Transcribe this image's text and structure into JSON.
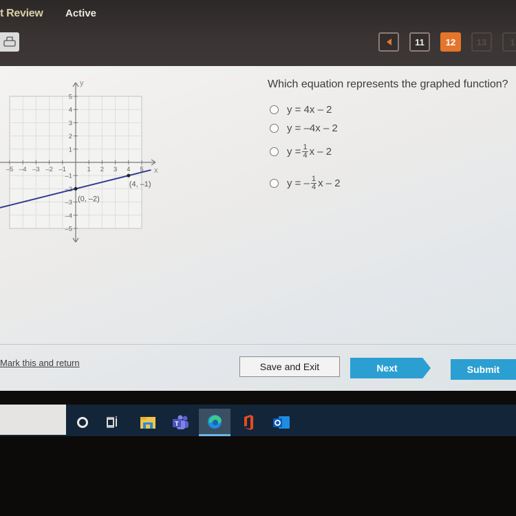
{
  "header": {
    "title": "t Review",
    "status": "Active",
    "print_icon": "printer-icon"
  },
  "question_nav": {
    "prev_icon": "triangle-left-icon",
    "items": [
      {
        "label": "11",
        "state": "visited"
      },
      {
        "label": "12",
        "state": "current"
      },
      {
        "label": "13",
        "state": "unvisited"
      },
      {
        "label": "1",
        "state": "unvisited"
      }
    ],
    "accent": "#e4752b"
  },
  "graph": {
    "axis_x_label": "x",
    "axis_y_label": "y",
    "x_range": [
      -5,
      5
    ],
    "y_range": [
      -5,
      5
    ],
    "x_ticks": [
      "-5",
      "-4",
      "-3",
      "-2",
      "-1",
      "1",
      "2",
      "3",
      "4",
      "5"
    ],
    "y_ticks": [
      "5",
      "4",
      "3",
      "2",
      "1",
      "-1",
      "-2",
      "-3",
      "-4",
      "-5"
    ],
    "line_color": "#2f3a8f",
    "points": [
      {
        "x": 0,
        "y": -2,
        "label": "(0, -2)"
      },
      {
        "x": 4,
        "y": -1,
        "label": "(4, -1)"
      }
    ],
    "line": {
      "slope": 0.25,
      "intercept": -2
    }
  },
  "question": {
    "text": "Which equation represents the graphed function?",
    "options": [
      {
        "prefix": "y = 4x – 2",
        "frac": null,
        "suffix": ""
      },
      {
        "prefix": "y = –4x – 2",
        "frac": null,
        "suffix": ""
      },
      {
        "prefix": "y = ",
        "frac": {
          "num": "1",
          "den": "4"
        },
        "suffix": "x – 2"
      },
      {
        "prefix": "y = –",
        "frac": {
          "num": "1",
          "den": "4"
        },
        "suffix": "x – 2"
      }
    ]
  },
  "footer": {
    "mark_link": "Mark this and return",
    "save_exit": "Save and Exit",
    "next": "Next",
    "submit": "Submit",
    "button_color": "#2b9fd1"
  },
  "taskbar": {
    "icons": [
      {
        "name": "cortana-icon"
      },
      {
        "name": "task-view-icon"
      },
      {
        "name": "file-explorer-icon"
      },
      {
        "name": "teams-icon"
      },
      {
        "name": "edge-icon",
        "active": true
      },
      {
        "name": "office-icon"
      },
      {
        "name": "outlook-icon"
      }
    ]
  }
}
